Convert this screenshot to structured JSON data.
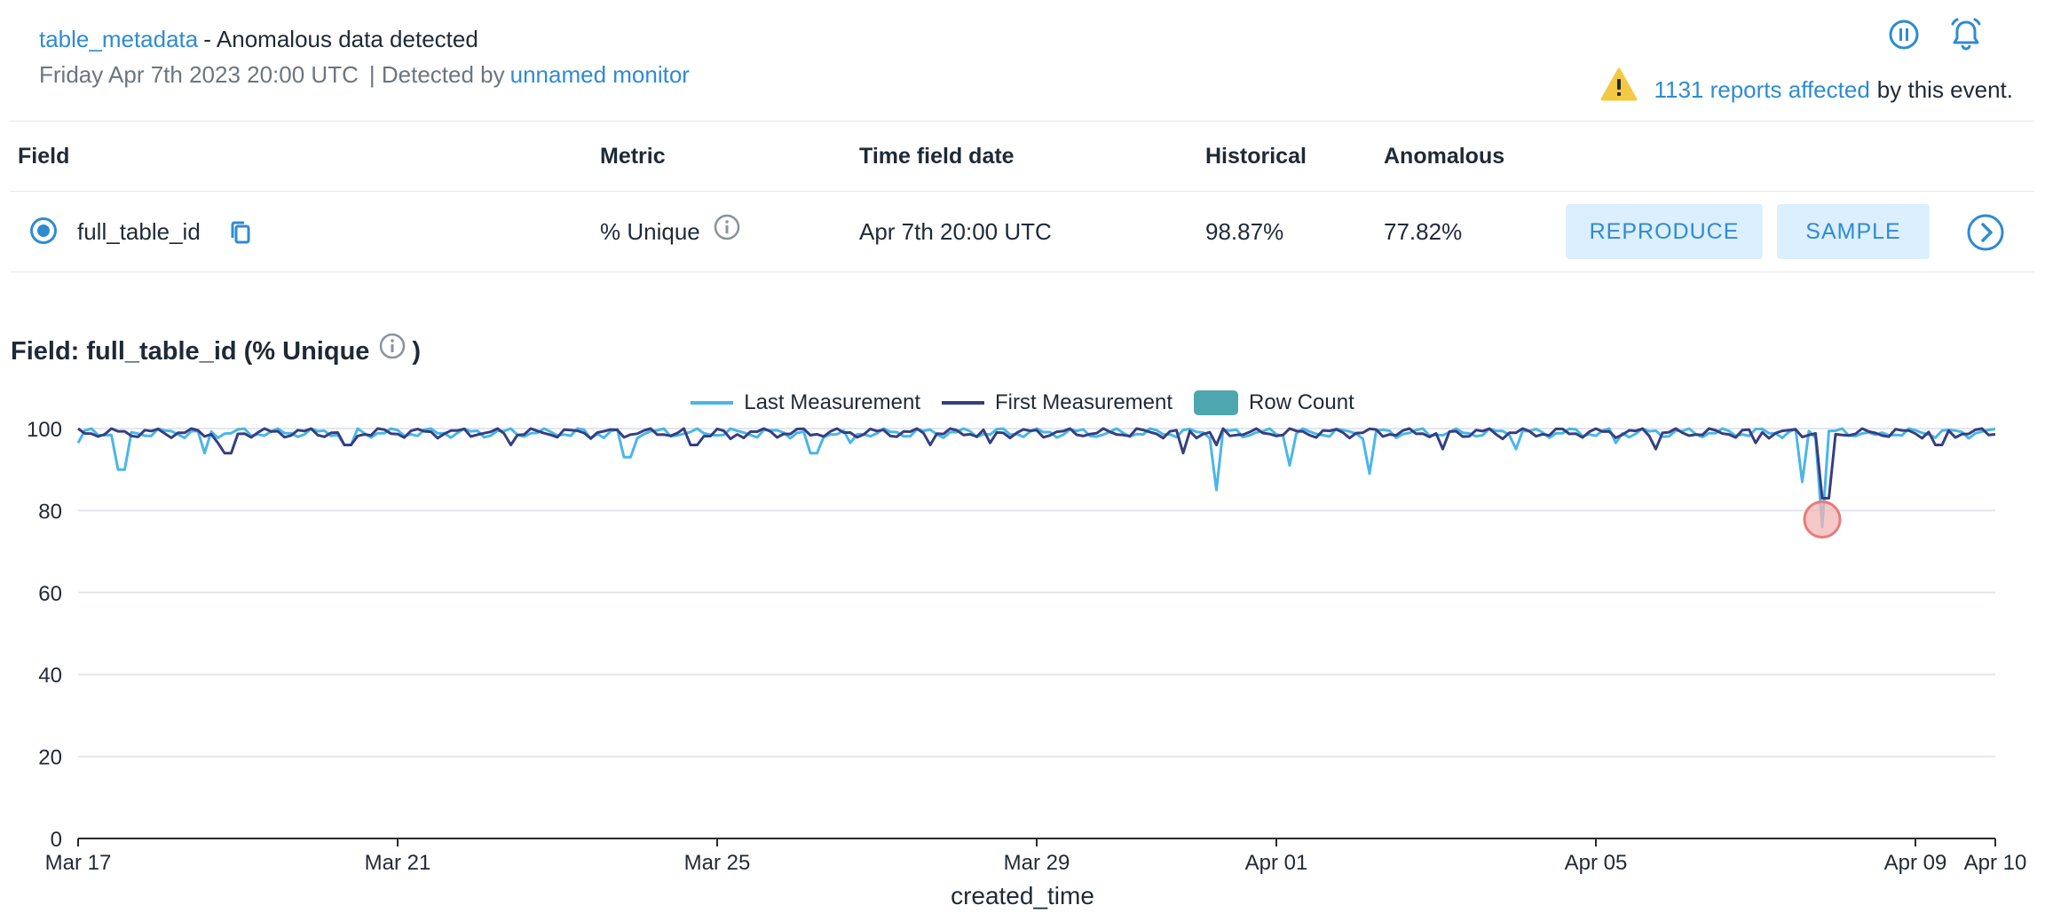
{
  "header": {
    "table_link": "table_metadata",
    "separator": "-",
    "title": "Anomalous data detected",
    "date": "Friday Apr 7th 2023 20:00 UTC",
    "detected_prefix": "| Detected by",
    "monitor_link": "unnamed monitor",
    "affected_link": "1131 reports affected",
    "affected_tail": "by this event.",
    "icons": [
      "pause-icon",
      "bell-icon"
    ]
  },
  "table": {
    "columns": [
      "Field",
      "Metric",
      "Time field date",
      "Historical",
      "Anomalous"
    ],
    "row": {
      "field": "full_table_id",
      "metric": "% Unique",
      "time": "Apr 7th 20:00 UTC",
      "historical": "98.87%",
      "anomalous": "77.82%",
      "reproduce_label": "REPRODUCE",
      "sample_label": "SAMPLE"
    }
  },
  "field_title": {
    "prefix": "Field: full_table_id (% Unique",
    "suffix": ")"
  },
  "legend": [
    {
      "label": "Last Measurement",
      "color": "#4ab6e8",
      "kind": "line"
    },
    {
      "label": "First Measurement",
      "color": "#353f80",
      "kind": "line"
    },
    {
      "label": "Row Count",
      "color": "#4ea7b0",
      "kind": "box"
    }
  ],
  "colors": {
    "accent": "#2f8bd0",
    "warning": "#f5c842",
    "anomaly": "#e87b7b"
  },
  "chart_data": {
    "type": "line",
    "xlabel": "created_time",
    "ylabel": "",
    "ylim": [
      0,
      100
    ],
    "xlim": [
      "2023-03-17",
      "2023-04-10"
    ],
    "yticks": [
      0,
      20,
      40,
      60,
      80,
      100
    ],
    "xticks": [
      "Mar 17",
      "Mar 21",
      "Mar 25",
      "Mar 29",
      "Apr 01",
      "Apr 05",
      "Apr 09",
      "Apr 10"
    ],
    "xtick_dates": [
      "2023-03-17",
      "2023-03-21",
      "2023-03-25",
      "2023-03-29",
      "2023-04-01",
      "2023-04-05",
      "2023-04-09",
      "2023-04-10"
    ],
    "grid": true,
    "baseline": 99,
    "series": [
      {
        "name": "Last Measurement",
        "color": "#4ab6e8",
        "dips": [
          {
            "x": "2023-03-17T13:00",
            "y": 90
          },
          {
            "x": "2023-03-18T14:00",
            "y": 94
          },
          {
            "x": "2023-03-20T09:00",
            "y": 96
          },
          {
            "x": "2023-03-23T21:00",
            "y": 93
          },
          {
            "x": "2023-03-26T05:00",
            "y": 94
          },
          {
            "x": "2023-03-31T06:00",
            "y": 85
          },
          {
            "x": "2023-04-01T04:00",
            "y": 91
          },
          {
            "x": "2023-04-02T04:00",
            "y": 89
          },
          {
            "x": "2023-04-04T00:00",
            "y": 95
          },
          {
            "x": "2023-04-07T14:00",
            "y": 87
          },
          {
            "x": "2023-04-07T20:00",
            "y": 76
          }
        ]
      },
      {
        "name": "First Measurement",
        "color": "#353f80",
        "dips": [
          {
            "x": "2023-03-18T21:00",
            "y": 94
          },
          {
            "x": "2023-03-20T09:00",
            "y": 96
          },
          {
            "x": "2023-03-22T10:00",
            "y": 96
          },
          {
            "x": "2023-03-24T17:00",
            "y": 96
          },
          {
            "x": "2023-03-27T16:00",
            "y": 96
          },
          {
            "x": "2023-03-30T20:00",
            "y": 94
          },
          {
            "x": "2023-03-31T06:00",
            "y": 96
          },
          {
            "x": "2023-04-03T02:00",
            "y": 95
          },
          {
            "x": "2023-04-05T18:00",
            "y": 95
          },
          {
            "x": "2023-04-07T21:00",
            "y": 83
          },
          {
            "x": "2023-04-09T07:00",
            "y": 96
          }
        ]
      }
    ],
    "anomaly_point": {
      "x": "2023-04-07T20:00",
      "y": 77.82
    }
  }
}
